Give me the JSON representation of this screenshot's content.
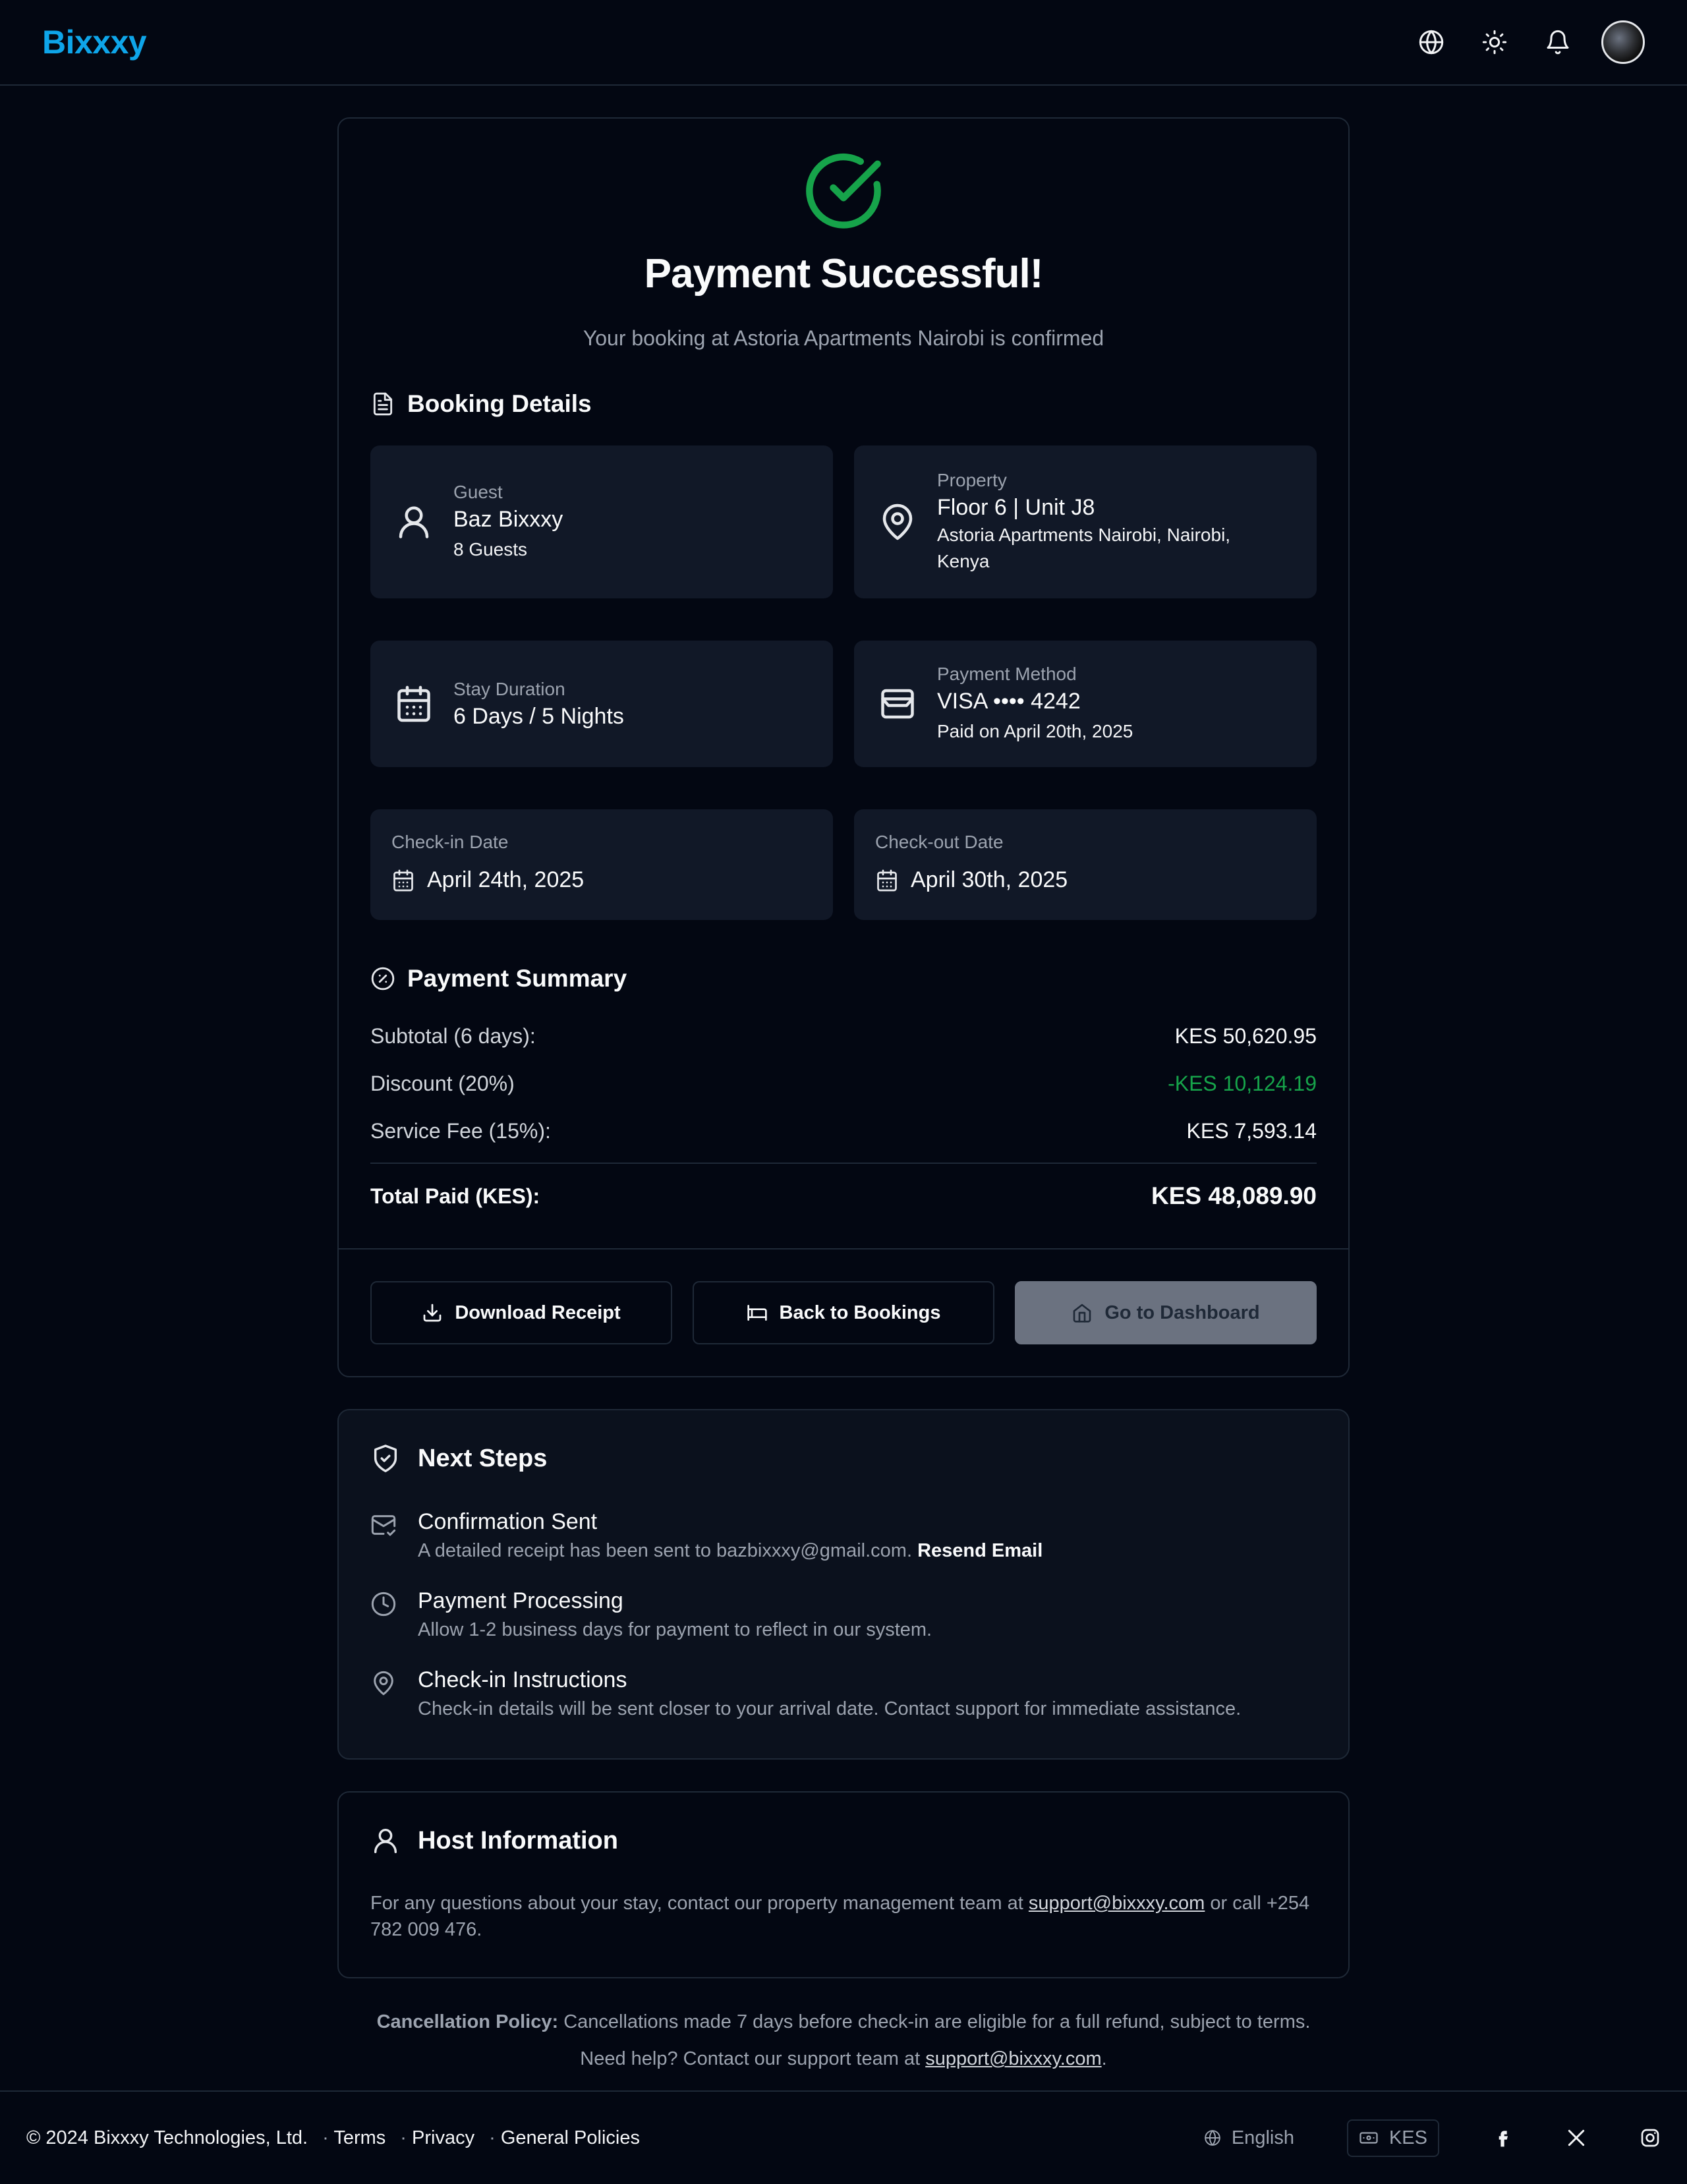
{
  "header": {
    "logo": "Bixxxy",
    "icons": [
      "globe-icon",
      "sun-icon",
      "bell-icon"
    ]
  },
  "success": {
    "title": "Payment Successful!",
    "subtitle": "Your booking at Astoria Apartments Nairobi is confirmed"
  },
  "booking": {
    "section_title": "Booking Details",
    "guest": {
      "label": "Guest",
      "name": "Baz Bixxxy",
      "count": "8 Guests"
    },
    "property": {
      "label": "Property",
      "unit": "Floor 6 | Unit J8",
      "address_line1": "Astoria Apartments Nairobi, Nairobi,",
      "address_line2": "Kenya"
    },
    "stay": {
      "label": "Stay Duration",
      "value": "6 Days / 5 Nights"
    },
    "payment_method": {
      "label": "Payment Method",
      "card": "VISA •••• 4242",
      "paid_on": "Paid on April 20th, 2025"
    },
    "check_in": {
      "label": "Check-in Date",
      "date": "April 24th, 2025"
    },
    "check_out": {
      "label": "Check-out Date",
      "date": "April 30th, 2025"
    }
  },
  "summary": {
    "section_title": "Payment Summary",
    "subtotal_label": "Subtotal (6 days):",
    "subtotal_value": "KES 50,620.95",
    "discount_label": "Discount (20%)",
    "discount_value": "-KES 10,124.19",
    "service_fee_label": "Service Fee (15%):",
    "service_fee_value": "KES 7,593.14",
    "total_label": "Total Paid (KES):",
    "total_value": "KES 48,089.90",
    "accent_green": "#16a34a"
  },
  "actions": {
    "download": "Download Receipt",
    "back": "Back to Bookings",
    "dashboard": "Go to Dashboard"
  },
  "next_steps": {
    "title": "Next Steps",
    "items": [
      {
        "title": "Confirmation Sent",
        "desc": "A detailed receipt has been sent to bazbixxxy@gmail.com.",
        "action": "Resend Email",
        "icon": "mail-check-icon"
      },
      {
        "title": "Payment Processing",
        "desc": "Allow 1-2 business days for payment to reflect in our system.",
        "icon": "clock-icon"
      },
      {
        "title": "Check-in Instructions",
        "desc": "Check-in details will be sent closer to your arrival date. Contact support for immediate assistance.",
        "icon": "map-pin-icon"
      }
    ]
  },
  "host": {
    "title": "Host Information",
    "text_before": "For any questions about your stay, contact our property management team at",
    "email": "support@bixxxy.com",
    "text_after": "or call",
    "phone": "+254 782 009 476."
  },
  "policy": {
    "label": "Cancellation Policy:",
    "text": "Cancellations made 7 days before check-in are eligible for a full refund, subject to terms.",
    "help_text": "Need help? Contact our support team at",
    "help_email": "support@bixxxy.com",
    "help_end": "."
  },
  "footer": {
    "copyright": "© 2024 Bixxxy Technologies, Ltd.",
    "links": [
      "Terms",
      "Privacy",
      "General Policies"
    ],
    "language": "English",
    "currency": "KES"
  },
  "colors": {
    "brand": "#0ea5e9",
    "success": "#16a34a"
  }
}
